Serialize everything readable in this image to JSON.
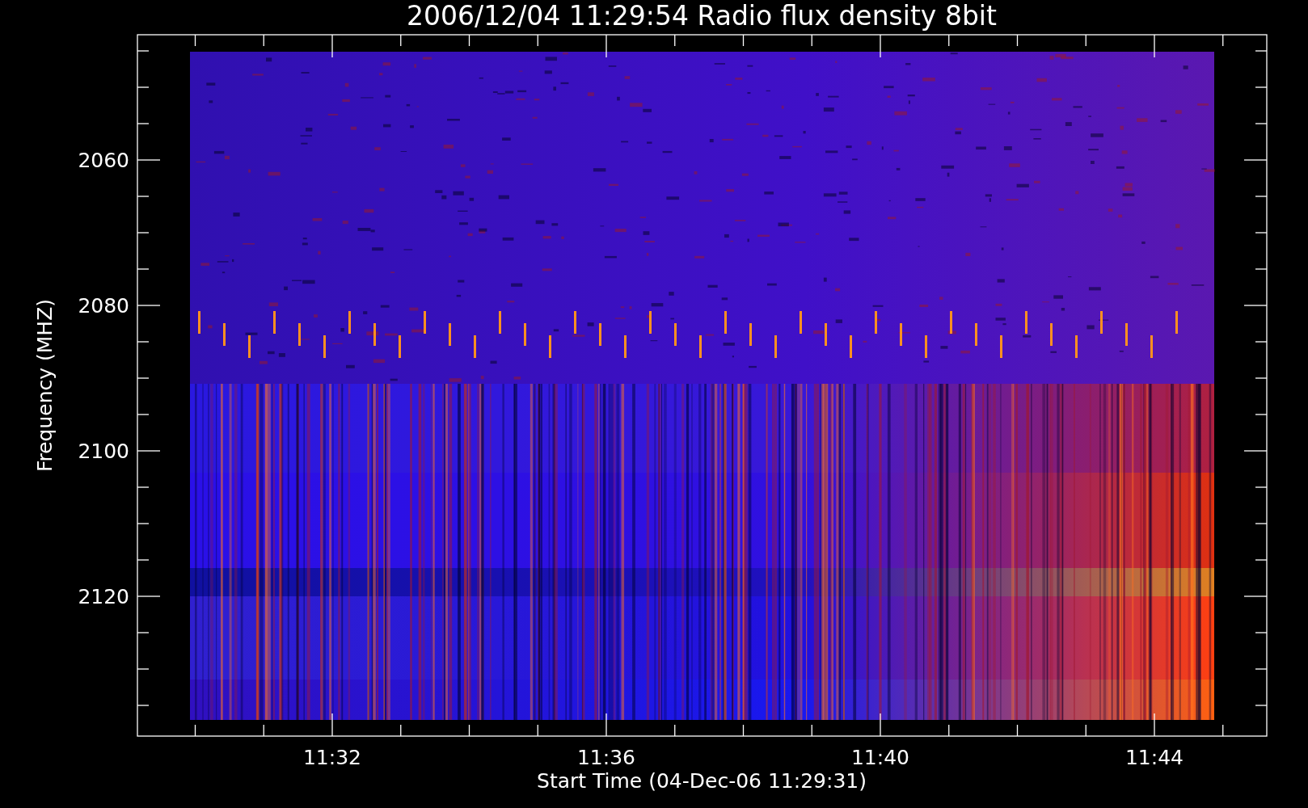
{
  "title": "2006/12/04 11:29:54 Radio flux density 8bit",
  "xlabel": "Start Time (04-Dec-06 11:29:31)",
  "ylabel": "Frequency (MHZ)",
  "xtick_labels": [
    "11:32",
    "11:36",
    "11:40",
    "11:44"
  ],
  "ytick_labels": [
    "2060",
    "2080",
    "2100",
    "2120"
  ]
}
